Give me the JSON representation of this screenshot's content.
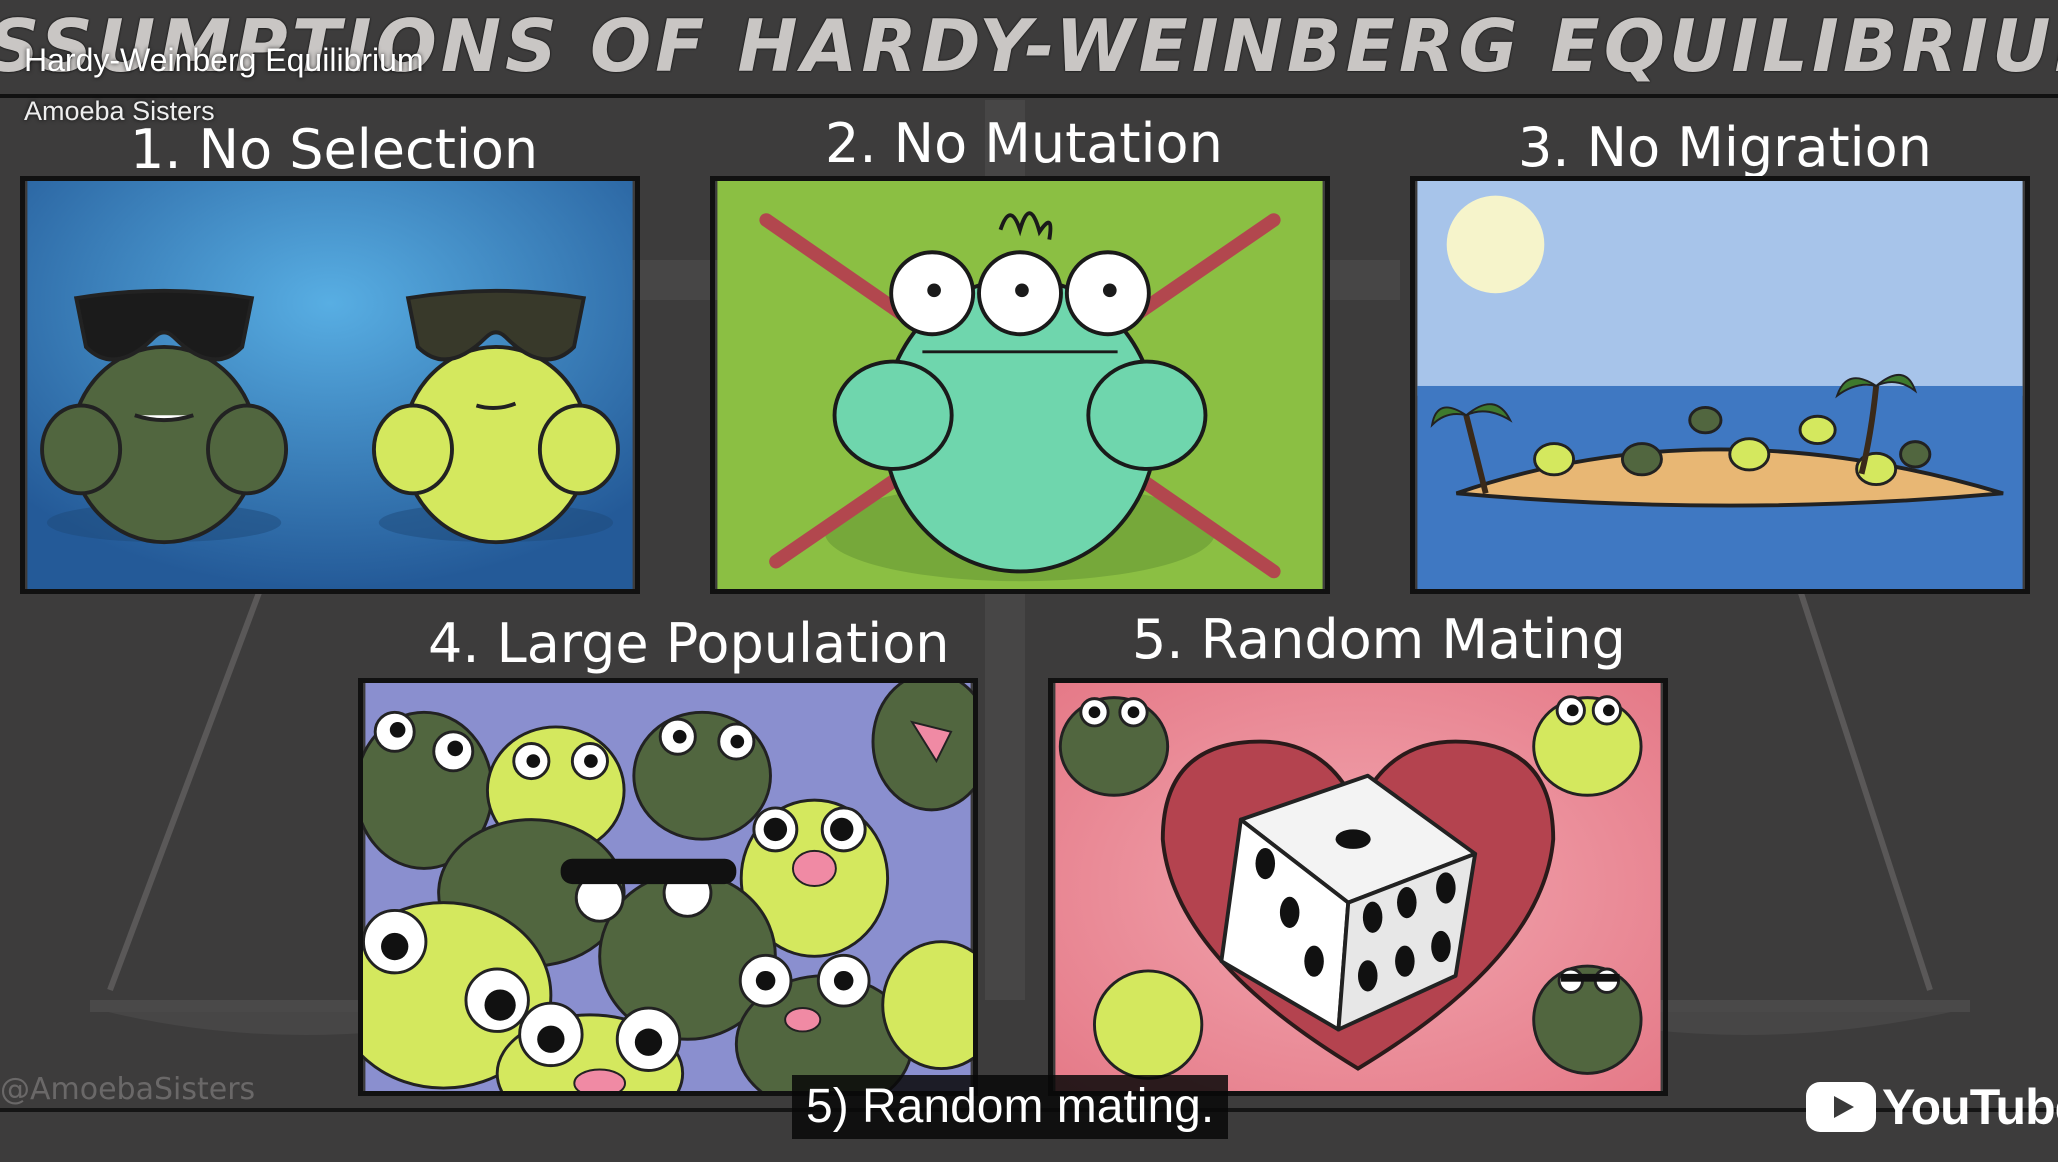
{
  "video": {
    "title": "Hardy-Weinberg Equilibrium",
    "channel": "Amoeba Sisters",
    "banner_title": "ASSUMPTIONS OF HARDY-WEINBERG EQUILIBRIUM",
    "watermark": "@AmoebaSisters",
    "subtitle": "5) Random mating.",
    "brand": "YouTube"
  },
  "panels": [
    {
      "label": "1. No Selection",
      "bg": "#2f6fae"
    },
    {
      "label": "2. No Mutation",
      "bg": "#8bbf43"
    },
    {
      "label": "3. No Migration",
      "bg": "#9fc1e6"
    },
    {
      "label": "4. Large Population",
      "bg": "#8a8fcf"
    },
    {
      "label": "5. Random Mating",
      "bg": "#ec8f98"
    }
  ],
  "colors": {
    "frog_dark": "#51663f",
    "frog_light": "#d4e85e",
    "frog_teal": "#6fd6ad",
    "youtube_red": "#ffffff"
  }
}
